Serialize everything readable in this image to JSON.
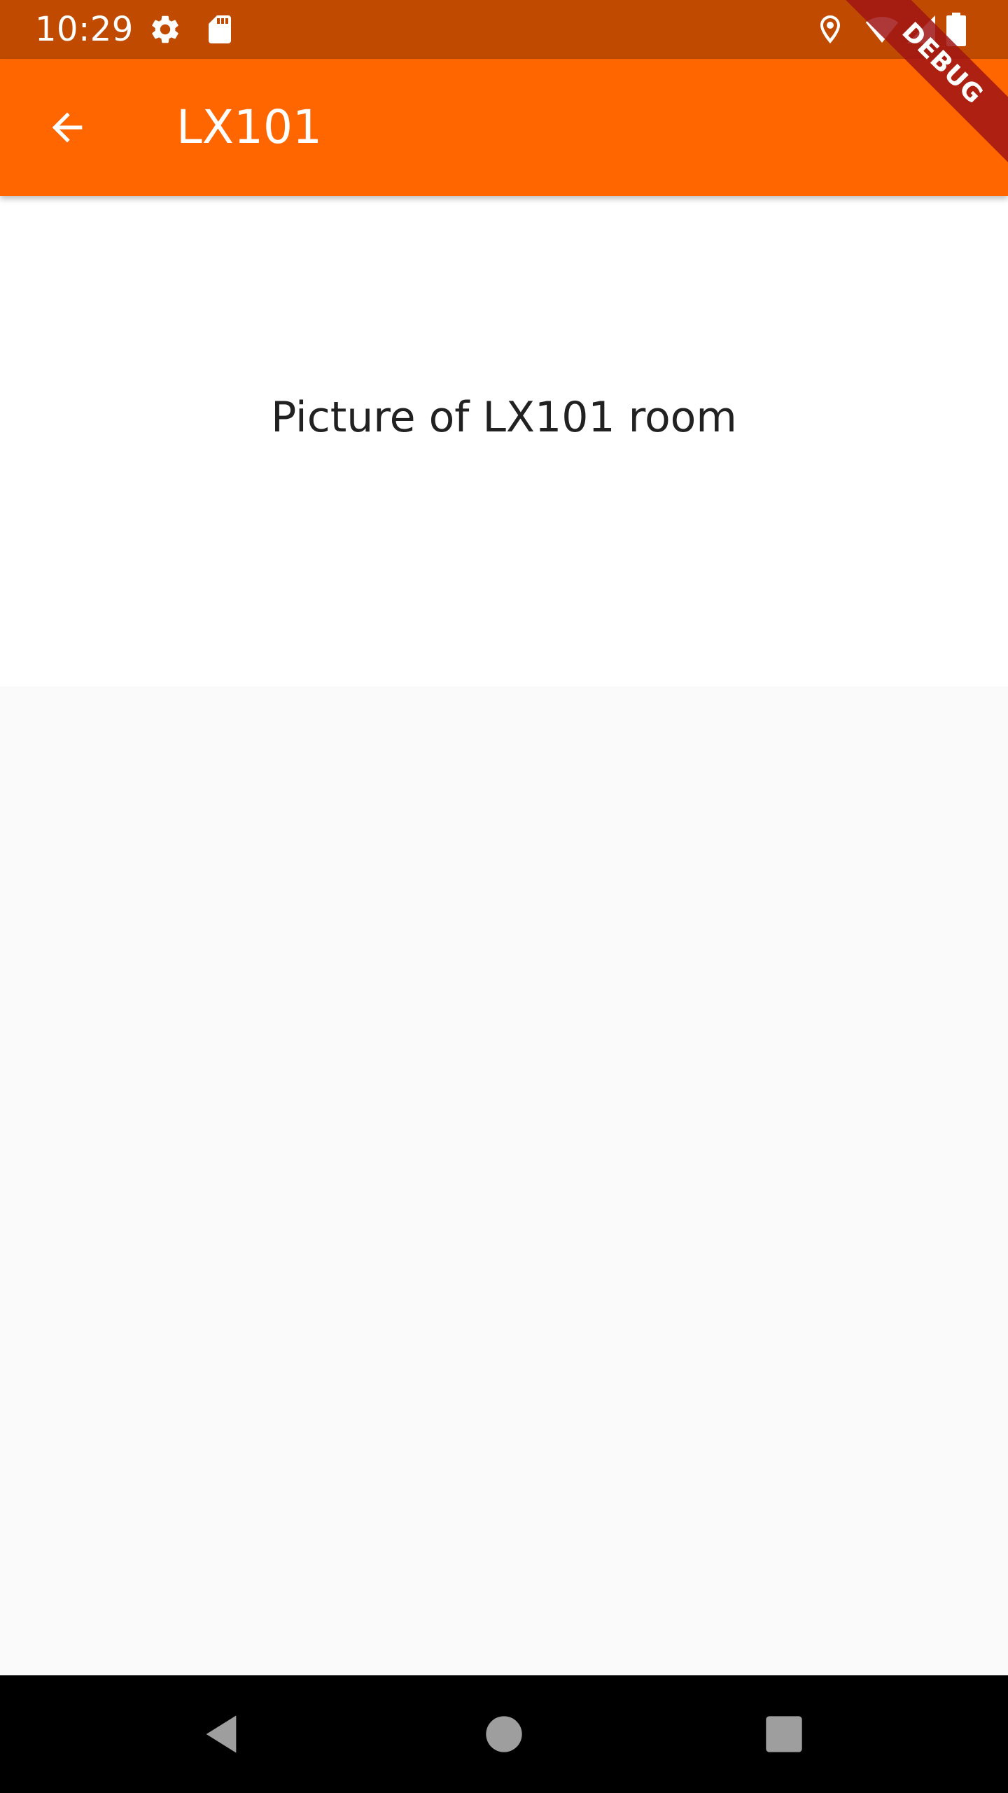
{
  "status_bar": {
    "time": "10:29",
    "icons": [
      "settings-gear-icon",
      "sd-card-icon",
      "location-pin-icon",
      "wifi-icon",
      "cell-signal-icon",
      "battery-icon"
    ]
  },
  "app_bar": {
    "title": "LX101",
    "back_icon": "arrow-back-icon",
    "background_color": "#ff6600"
  },
  "debug_banner": {
    "label": "DEBUG"
  },
  "content": {
    "picture_caption": "Picture of LX101 room"
  },
  "nav_bar": {
    "buttons": [
      "back-triangle-icon",
      "home-circle-icon",
      "recents-square-icon"
    ]
  },
  "colors": {
    "status_bar": "#c04b00",
    "accent": "#ff6600",
    "background": "#fafafa"
  }
}
